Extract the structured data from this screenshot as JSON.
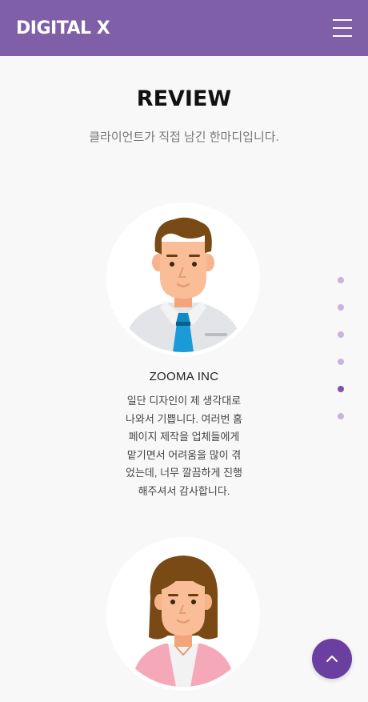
{
  "header": {
    "logo": "DIGITAL X",
    "menu_icon": "hamburger-menu-icon"
  },
  "section": {
    "title": "REVIEW",
    "subtitle": "클라이언트가 직접 남긴 한마디입니다."
  },
  "reviews": [
    {
      "company": "ZOOMA INC",
      "avatar": "male-avatar-icon",
      "lines": [
        "일단 디자인이 제 생각대로",
        "나와서 기쁩니다. 여러번 홈",
        "페이지 제작을 업체들에게",
        "맡기면서 어려움을 많이 겪",
        "었는데, 너무 깔끔하게 진행",
        "해주셔서 감사합니다."
      ]
    },
    {
      "avatar": "female-avatar-icon"
    }
  ],
  "pagination": {
    "count": 6,
    "active_index": 4
  },
  "scroll_top": {
    "icon": "chevron-up-icon"
  },
  "colors": {
    "header_bg": "#7f5fa8",
    "dot_inactive": "#c8b4dc",
    "dot_active": "#8054a6",
    "top_button": "#6b3fa0"
  }
}
